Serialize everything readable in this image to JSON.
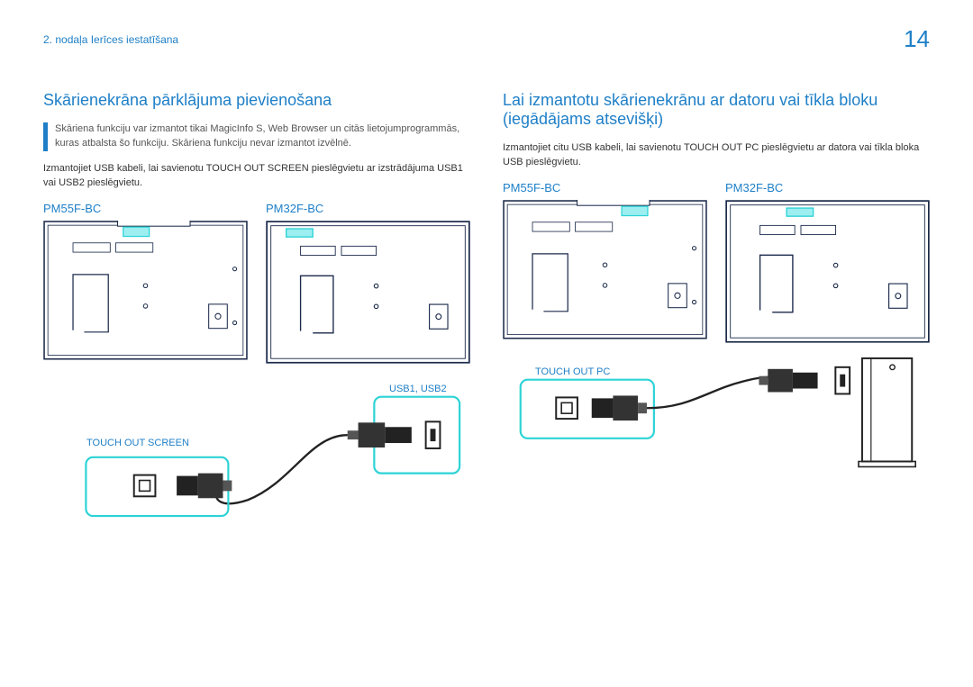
{
  "header": {
    "chapter": "2. nodaļa Ierīces iestatīšana",
    "page_number": "14"
  },
  "left": {
    "title": "Skārienekrāna pārklājuma pievienošana",
    "note": "Skāriena funkciju var izmantot tikai MagicInfo S, Web Browser un citās lietojumprogrammās, kuras atbalsta šo funkciju. Skāriena funkciju nevar izmantot izvēlnē.",
    "body": "Izmantojiet USB kabeli, lai savienotu TOUCH OUT SCREEN pieslēgvietu ar izstrādājuma USB1 vai USB2 pieslēgvietu.",
    "model_a": "PM55F-BC",
    "model_b": "PM32F-BC",
    "touch_out_label": "TOUCH OUT SCREEN",
    "usb_label": "USB1, USB2"
  },
  "right": {
    "title": "Lai izmantotu skārienekrānu ar datoru vai tīkla bloku (iegādājams atsevišķi)",
    "body": "Izmantojiet citu USB kabeli, lai savienotu TOUCH OUT PC pieslēgvietu ar datora vai tīkla bloka USB pieslēgvietu.",
    "model_a": "PM55F-BC",
    "model_b": "PM32F-BC",
    "touch_out_label": "TOUCH OUT PC"
  }
}
